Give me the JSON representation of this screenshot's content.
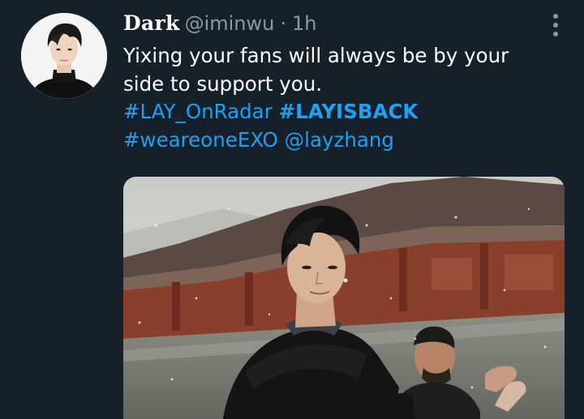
{
  "tweet": {
    "author": {
      "display_name": "Dark",
      "handle": "@iminwu"
    },
    "separator": "·",
    "timestamp": "1h",
    "text": {
      "line1": "Yixing your fans will always be by your",
      "line2": "side to support you.",
      "hashtag1": "#LAY_OnRadar",
      "hashtag2": "#LAYISBACK",
      "hashtag3": "#weareoneEXO",
      "mention": "@layzhang"
    },
    "colors": {
      "background": "#15202b",
      "text": "#ffffff",
      "secondary": "#8899a6",
      "link": "#1da1f2"
    },
    "icons": {
      "more": "more-vertical-icon"
    }
  }
}
